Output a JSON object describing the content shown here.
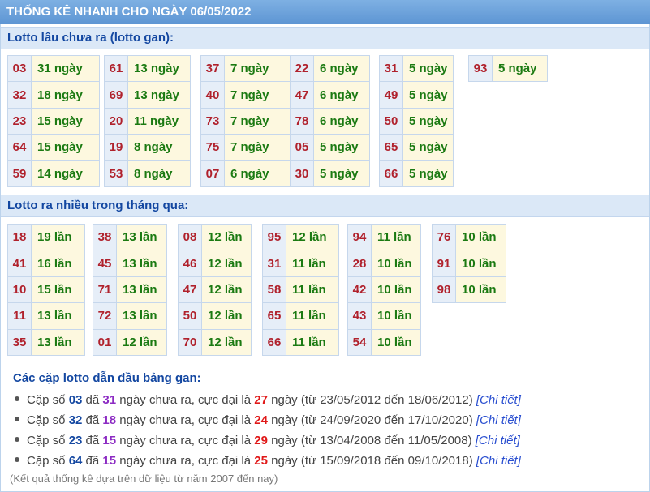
{
  "title": "THỐNG KÊ NHANH CHO NGÀY 06/05/2022",
  "gan": {
    "heading": "Lotto lâu chưa ra (lotto gan):",
    "groups": [
      [
        [
          "03",
          "31 ngày"
        ],
        [
          "32",
          "18 ngày"
        ],
        [
          "23",
          "15 ngày"
        ],
        [
          "64",
          "15 ngày"
        ],
        [
          "59",
          "14 ngày"
        ]
      ],
      [
        [
          "61",
          "13 ngày"
        ],
        [
          "69",
          "13 ngày"
        ],
        [
          "20",
          "11 ngày"
        ],
        [
          "19",
          "8 ngày"
        ],
        [
          "53",
          "8 ngày"
        ]
      ],
      [
        [
          "37",
          "7 ngày"
        ],
        [
          "40",
          "7 ngày"
        ],
        [
          "73",
          "7 ngày"
        ],
        [
          "75",
          "7 ngày"
        ],
        [
          "07",
          "6 ngày"
        ]
      ],
      [
        [
          "22",
          "6 ngày"
        ],
        [
          "47",
          "6 ngày"
        ],
        [
          "78",
          "6 ngày"
        ],
        [
          "05",
          "5 ngày"
        ],
        [
          "30",
          "5 ngày"
        ]
      ],
      [
        [
          "31",
          "5 ngày"
        ],
        [
          "49",
          "5 ngày"
        ],
        [
          "50",
          "5 ngày"
        ],
        [
          "65",
          "5 ngày"
        ],
        [
          "66",
          "5 ngày"
        ]
      ],
      [
        [
          "93",
          "5 ngày"
        ]
      ]
    ]
  },
  "frequent": {
    "heading": "Lotto ra nhiều trong tháng qua:",
    "groups": [
      [
        [
          "18",
          "19 lần"
        ],
        [
          "41",
          "16 lần"
        ],
        [
          "10",
          "15 lần"
        ],
        [
          "11",
          "13 lần"
        ],
        [
          "35",
          "13 lần"
        ]
      ],
      [
        [
          "38",
          "13 lần"
        ],
        [
          "45",
          "13 lần"
        ],
        [
          "71",
          "13 lần"
        ],
        [
          "72",
          "13 lần"
        ],
        [
          "01",
          "12 lần"
        ]
      ],
      [
        [
          "08",
          "12 lần"
        ],
        [
          "46",
          "12 lần"
        ],
        [
          "47",
          "12 lần"
        ],
        [
          "50",
          "12 lần"
        ],
        [
          "70",
          "12 lần"
        ]
      ],
      [
        [
          "95",
          "12 lần"
        ],
        [
          "31",
          "11 lần"
        ],
        [
          "58",
          "11 lần"
        ],
        [
          "65",
          "11 lần"
        ],
        [
          "66",
          "11 lần"
        ]
      ],
      [
        [
          "94",
          "11 lần"
        ],
        [
          "28",
          "10 lần"
        ],
        [
          "42",
          "10 lần"
        ],
        [
          "43",
          "10 lần"
        ],
        [
          "54",
          "10 lần"
        ]
      ],
      [
        [
          "76",
          "10 lần"
        ],
        [
          "91",
          "10 lần"
        ],
        [
          "98",
          "10 lần"
        ]
      ]
    ]
  },
  "pairs": {
    "heading": "Các cặp lotto dẫn đầu bảng gan:",
    "items": [
      {
        "pre": "Cặp số ",
        "num": "03",
        "mid1": " đã ",
        "days": "31",
        "mid2": " ngày chưa ra, cực đại là ",
        "max": "27",
        "range": " ngày (từ 23/05/2012 đến 18/06/2012) ",
        "link": "[Chi tiết]"
      },
      {
        "pre": "Cặp số ",
        "num": "32",
        "mid1": " đã ",
        "days": "18",
        "mid2": " ngày chưa ra, cực đại là ",
        "max": "24",
        "range": " ngày (từ 24/09/2020 đến 17/10/2020) ",
        "link": "[Chi tiết]"
      },
      {
        "pre": "Cặp số ",
        "num": "23",
        "mid1": " đã ",
        "days": "15",
        "mid2": " ngày chưa ra, cực đại là ",
        "max": "29",
        "range": " ngày (từ 13/04/2008 đến 11/05/2008) ",
        "link": "[Chi tiết]"
      },
      {
        "pre": "Cặp số ",
        "num": "64",
        "mid1": " đã ",
        "days": "15",
        "mid2": " ngày chưa ra, cực đại là ",
        "max": "25",
        "range": " ngày (từ 15/09/2018 đến 09/10/2018) ",
        "link": "[Chi tiết]"
      }
    ]
  },
  "note": "(Kết quả thống kê dựa trên dữ liệu từ năm 2007 đến nay)"
}
